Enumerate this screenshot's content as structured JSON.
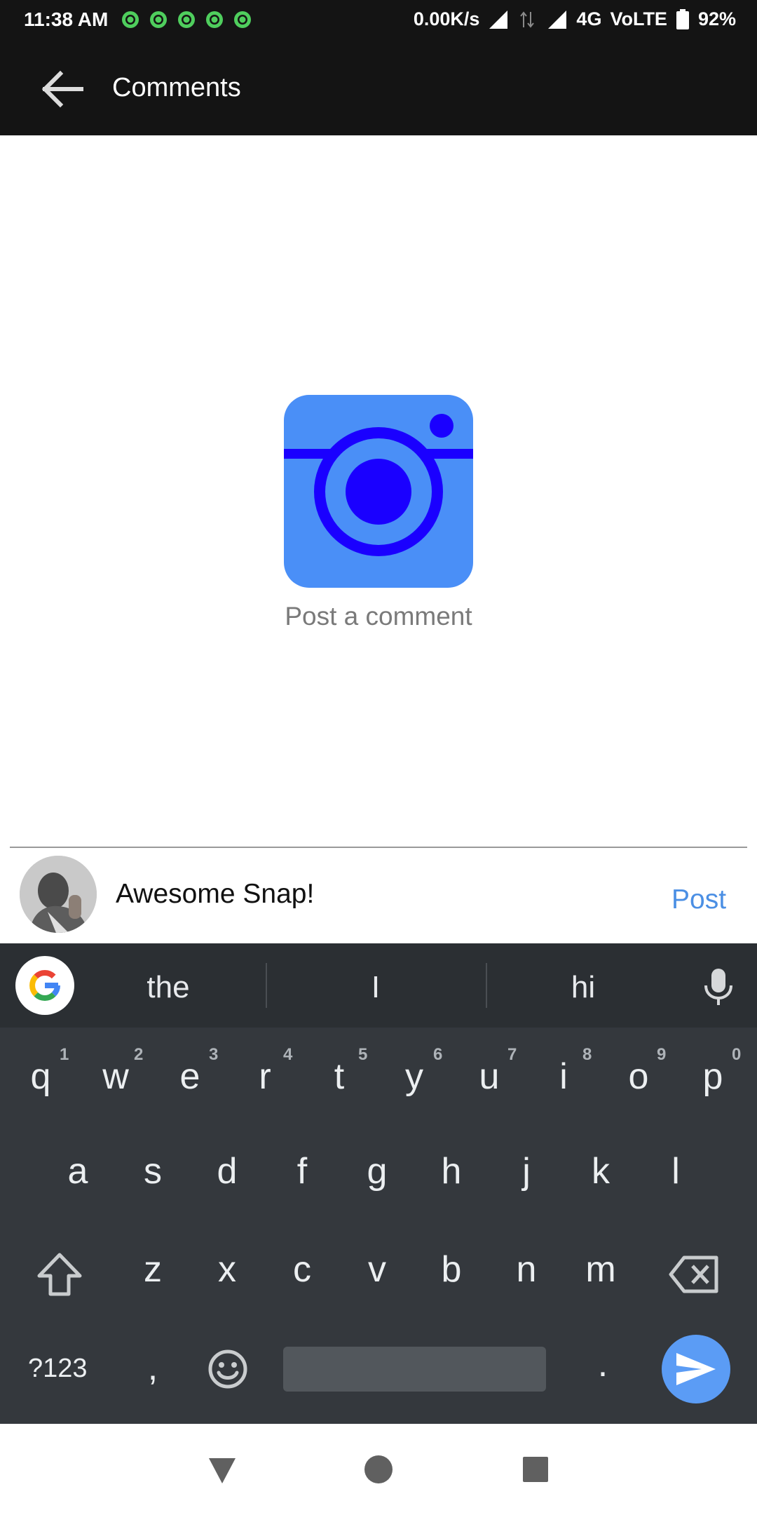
{
  "status_bar": {
    "time": "11:38 AM",
    "notification_icons": [
      "whatsapp-icon",
      "whatsapp-icon",
      "whatsapp-icon",
      "whatsapp-icon",
      "whatsapp-icon"
    ],
    "net_speed": "0.00K/s",
    "network": "4G",
    "volte": "VoLTE",
    "battery": "92%"
  },
  "app_bar": {
    "title": "Comments",
    "back_icon": "arrow-left-icon"
  },
  "empty_state": {
    "icon": "camera-icon",
    "text": "Post a comment"
  },
  "composer": {
    "avatar_icon": "user-avatar",
    "input_value": "Awesome Snap!",
    "post_label": "Post"
  },
  "keyboard": {
    "suggestions": [
      "the",
      "I",
      "hi"
    ],
    "row1": [
      "q",
      "w",
      "e",
      "r",
      "t",
      "y",
      "u",
      "i",
      "o",
      "p"
    ],
    "row1_hints": [
      "1",
      "2",
      "3",
      "4",
      "5",
      "6",
      "7",
      "8",
      "9",
      "0"
    ],
    "row2": [
      "a",
      "s",
      "d",
      "f",
      "g",
      "h",
      "j",
      "k",
      "l"
    ],
    "row3": [
      "z",
      "x",
      "c",
      "v",
      "b",
      "n",
      "m"
    ],
    "symbols_label": "?123",
    "comma": ",",
    "period": "."
  },
  "colors": {
    "app_bar": "#141414",
    "accent": "#4b8fe4",
    "camera_body": "#4a8ff7",
    "camera_lens": "#1a00ff",
    "keyboard_bg": "#34383d"
  }
}
